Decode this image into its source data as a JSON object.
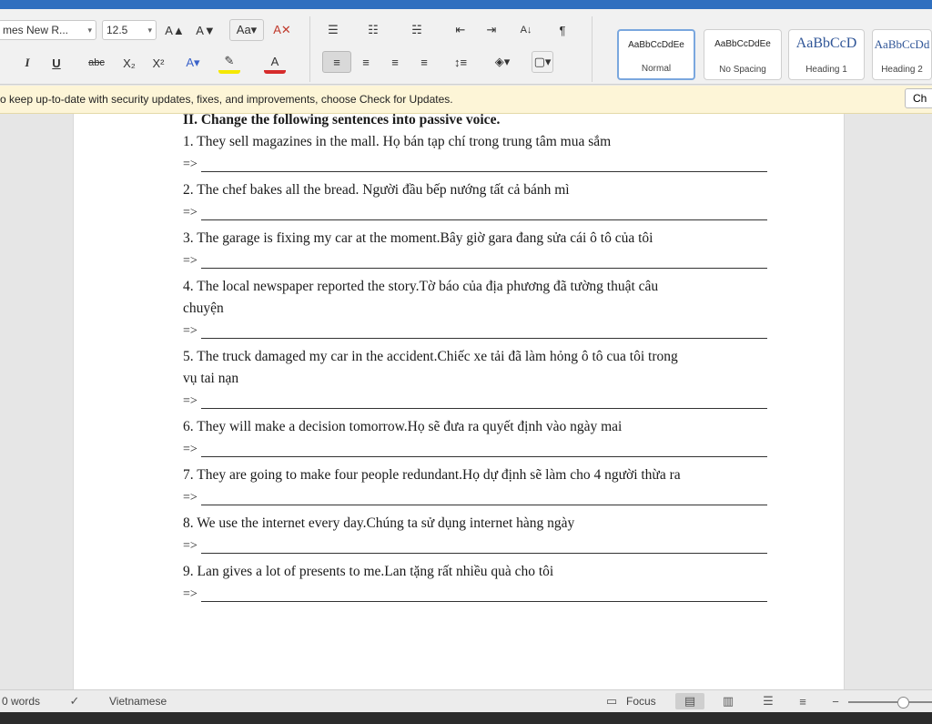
{
  "ribbon": {
    "font_name": "mes New R...",
    "font_size": "12.5",
    "grow_font": "A▲",
    "shrink_font": "A▼",
    "styles": [
      {
        "sample": "AaBbCcDdEe",
        "name": "Normal"
      },
      {
        "sample": "AaBbCcDdEe",
        "name": "No Spacing"
      },
      {
        "sample": "AaBbCcD",
        "name": "Heading 1"
      },
      {
        "sample": "AaBbCcDd",
        "name": "Heading 2"
      }
    ]
  },
  "message_bar": {
    "text": "o keep up-to-date with security updates, fixes, and improvements, choose Check for Updates.",
    "button": "Ch"
  },
  "document": {
    "heading": "II. Change the following sentences into passive voice.",
    "answer_prefix": "=>",
    "items": [
      {
        "lines": [
          "1. They sell magazines in the mall. Họ bán tạp chí trong trung tâm mua sắm"
        ]
      },
      {
        "lines": [
          "2. The chef bakes all the bread. Người đầu bếp nướng tất cả bánh mì"
        ]
      },
      {
        "lines": [
          "3. The garage is fixing my car at the moment.Bây giờ gara đang sửa cái ô tô của tôi"
        ]
      },
      {
        "lines": [
          "4. The local newspaper reported the story.Tờ báo của địa phương đã tường thuật câu",
          "chuyện"
        ]
      },
      {
        "lines": [
          "5. The truck damaged my car in the accident.Chiếc xe tải đã làm hỏng ô tô cua tôi trong",
          "vụ tai nạn"
        ]
      },
      {
        "lines": [
          "6. They will make a decision tomorrow.Họ sẽ đưa ra quyết định vào ngày mai"
        ]
      },
      {
        "lines": [
          "7. They are going to make four people redundant.Họ dự định sẽ làm cho 4 người thừa ra"
        ]
      },
      {
        "lines": [
          "8. We use the internet every day.Chúng ta sử dụng internet hàng ngày"
        ]
      },
      {
        "lines": [
          "9. Lan gives a lot of presents to me.Lan tặng rất nhiều quà cho tôi"
        ]
      }
    ]
  },
  "status": {
    "words": "0 words",
    "language": "Vietnamese",
    "focus": "Focus"
  }
}
